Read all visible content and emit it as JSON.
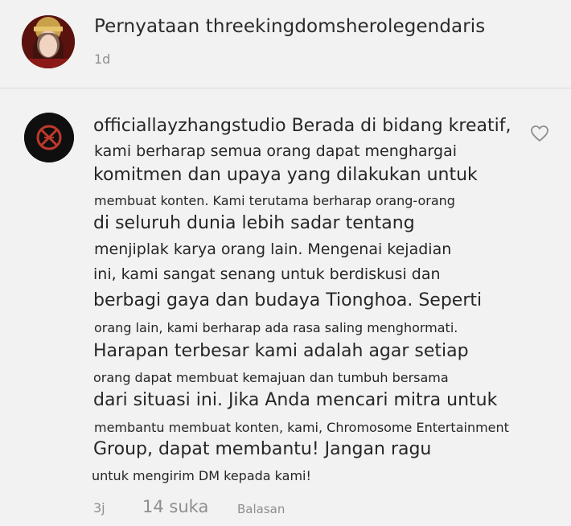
{
  "post": {
    "caption_header": "Pernyataan threekingdomsherolegendaris",
    "time": "1d"
  },
  "comment": {
    "lines": [
      "officiallayzhangstudio Berada di bidang kreatif,",
      "kami berharap semua orang dapat menghargai",
      "komitmen dan upaya yang dilakukan untuk",
      "membuat konten. Kami terutama berharap orang-orang",
      "di seluruh dunia lebih sadar tentang",
      "menjiplak karya orang lain. Mengenai kejadian",
      "ini, kami sangat senang untuk berdiskusi dan",
      "berbagi gaya dan budaya Tionghoa. Seperti",
      "orang lain, kami berharap ada rasa saling menghormati.",
      "Harapan terbesar kami adalah agar setiap",
      "orang dapat membuat kemajuan dan tumbuh bersama",
      "dari situasi ini. Jika Anda mencari mitra untuk",
      "membantu membuat konten, kami, Chromosome Entertainment",
      "Group, dapat membantu! Jangan ragu",
      "untuk mengirim DM kepada kami!"
    ],
    "time": "3j",
    "likes": "14 suka",
    "reply_label": "Balasan"
  },
  "icons": {
    "like": "heart-outline-icon",
    "accent": "#c0392b"
  }
}
